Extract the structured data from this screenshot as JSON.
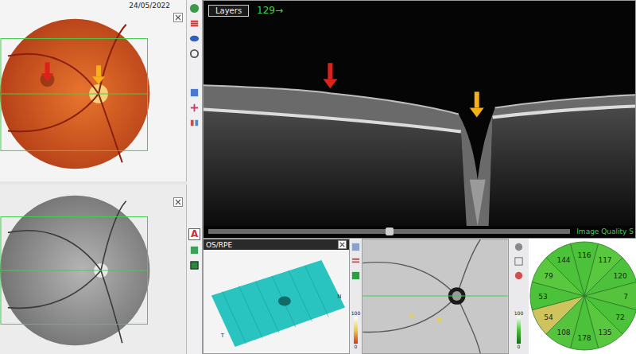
{
  "fundus": {
    "date": "24/05/2022"
  },
  "oct": {
    "mode_button": "Layers",
    "scan_index": "129→",
    "quality_label": "Image Quality S",
    "scan_slider": {
      "level": 0.5
    }
  },
  "tool_strip": {
    "text_tool": "A"
  },
  "surface_panel": {
    "title": "OS/RPE"
  },
  "color_scales": [
    {
      "max": "100",
      "min": "0"
    },
    {
      "max": "100",
      "min": "0"
    }
  ],
  "sectors": [
    {
      "value": "116",
      "color": "#4cc13a"
    },
    {
      "value": "117",
      "color": "#5ac83e"
    },
    {
      "value": "120",
      "color": "#4cc13a"
    },
    {
      "value": "7",
      "color": "#55c43c"
    },
    {
      "value": "72",
      "color": "#4cc13a"
    },
    {
      "value": "135",
      "color": "#5ac83e"
    },
    {
      "value": "178",
      "color": "#4cc13a"
    },
    {
      "value": "108",
      "color": "#55c43c"
    },
    {
      "value": "54",
      "color": "#cfc35e"
    },
    {
      "value": "53",
      "color": "#4cc13a"
    },
    {
      "value": "79",
      "color": "#5ac83e"
    },
    {
      "value": "144",
      "color": "#4cc13a"
    }
  ]
}
